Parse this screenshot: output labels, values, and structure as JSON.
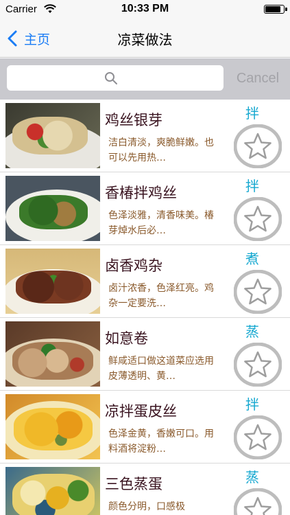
{
  "status_bar": {
    "carrier": "Carrier",
    "time": "10:33 PM",
    "battery_level": 0.9
  },
  "nav": {
    "back_label": "主页",
    "title": "凉菜做法"
  },
  "search": {
    "value": "",
    "placeholder": "",
    "cancel_label": "Cancel"
  },
  "colors": {
    "accent": "#1a7cf5",
    "method": "#16a8d0",
    "name": "#3a1420",
    "desc": "#8a5a2c"
  },
  "recipes": [
    {
      "name": "鸡丝银芽",
      "desc": "洁白清淡，爽脆鲜嫩。也可以先用热…",
      "method": "拌",
      "favorite_icon": "star-outline-icon"
    },
    {
      "name": "香椿拌鸡丝",
      "desc": "色泽淡雅，清香味美。椿芽焯水后必…",
      "method": "拌",
      "favorite_icon": "star-outline-icon"
    },
    {
      "name": "卤香鸡杂",
      "desc": "卤汁浓香，色泽红亮。鸡杂一定要洗…",
      "method": "煮",
      "favorite_icon": "star-outline-icon"
    },
    {
      "name": "如意卷",
      "desc": "鲜咸适口做这道菜应选用皮薄透明、黄…",
      "method": "蒸",
      "favorite_icon": "star-outline-icon"
    },
    {
      "name": "凉拌蛋皮丝",
      "desc": "色泽金黄，香嫩可口。用料酒将淀粉…",
      "method": "拌",
      "favorite_icon": "star-outline-icon"
    },
    {
      "name": "三色蒸蛋",
      "desc": "颜色分明，口感极",
      "method": "蒸",
      "favorite_icon": "star-outline-icon"
    }
  ]
}
